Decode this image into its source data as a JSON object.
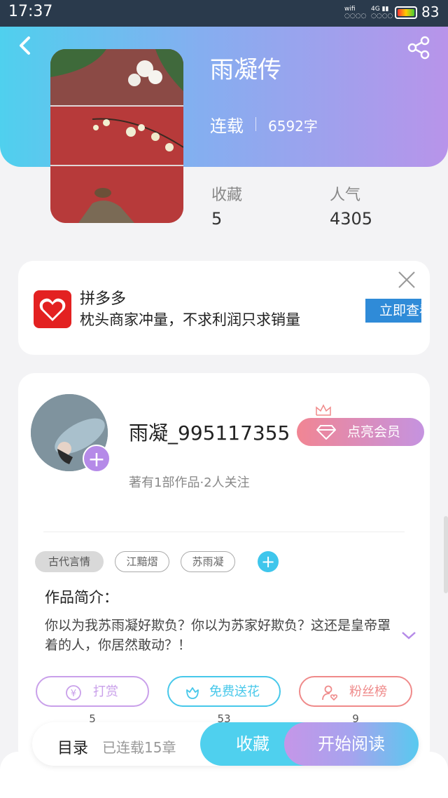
{
  "status": {
    "time": "17:37",
    "signal_text": "wifi",
    "network": "4G",
    "battery": "83"
  },
  "book": {
    "title": "雨凝传",
    "status": "连载",
    "word_count": "6592字"
  },
  "stats": [
    {
      "label": "收藏",
      "value": "5"
    },
    {
      "label": "人气",
      "value": "4305"
    }
  ],
  "ad": {
    "brand": "拼多多",
    "slogan": "枕头商家冲量，不求利润只求销量",
    "button": "立即查看"
  },
  "author": {
    "name": "雨凝_995117355",
    "meta": "著有1部作品·2人关注",
    "vip_label": "点亮会员"
  },
  "tags": [
    "古代言情",
    "江黯熠",
    "苏雨凝"
  ],
  "intro": {
    "title": "作品简介：",
    "text": "你以为我苏雨凝好欺负？你以为苏家好欺负？这还是皇帝罩着的人，你居然敢动？！"
  },
  "actions": [
    {
      "label": "打赏",
      "count": "5",
      "color": "#c9a0ea"
    },
    {
      "label": "免费送花",
      "count": "53",
      "color": "#47c8ea"
    },
    {
      "label": "粉丝榜",
      "count": "9",
      "color": "#ef8a8a"
    }
  ],
  "bottom": {
    "toc": "目录",
    "toc_sub": "已连载15章",
    "favorite": "收藏",
    "read": "开始阅读"
  }
}
